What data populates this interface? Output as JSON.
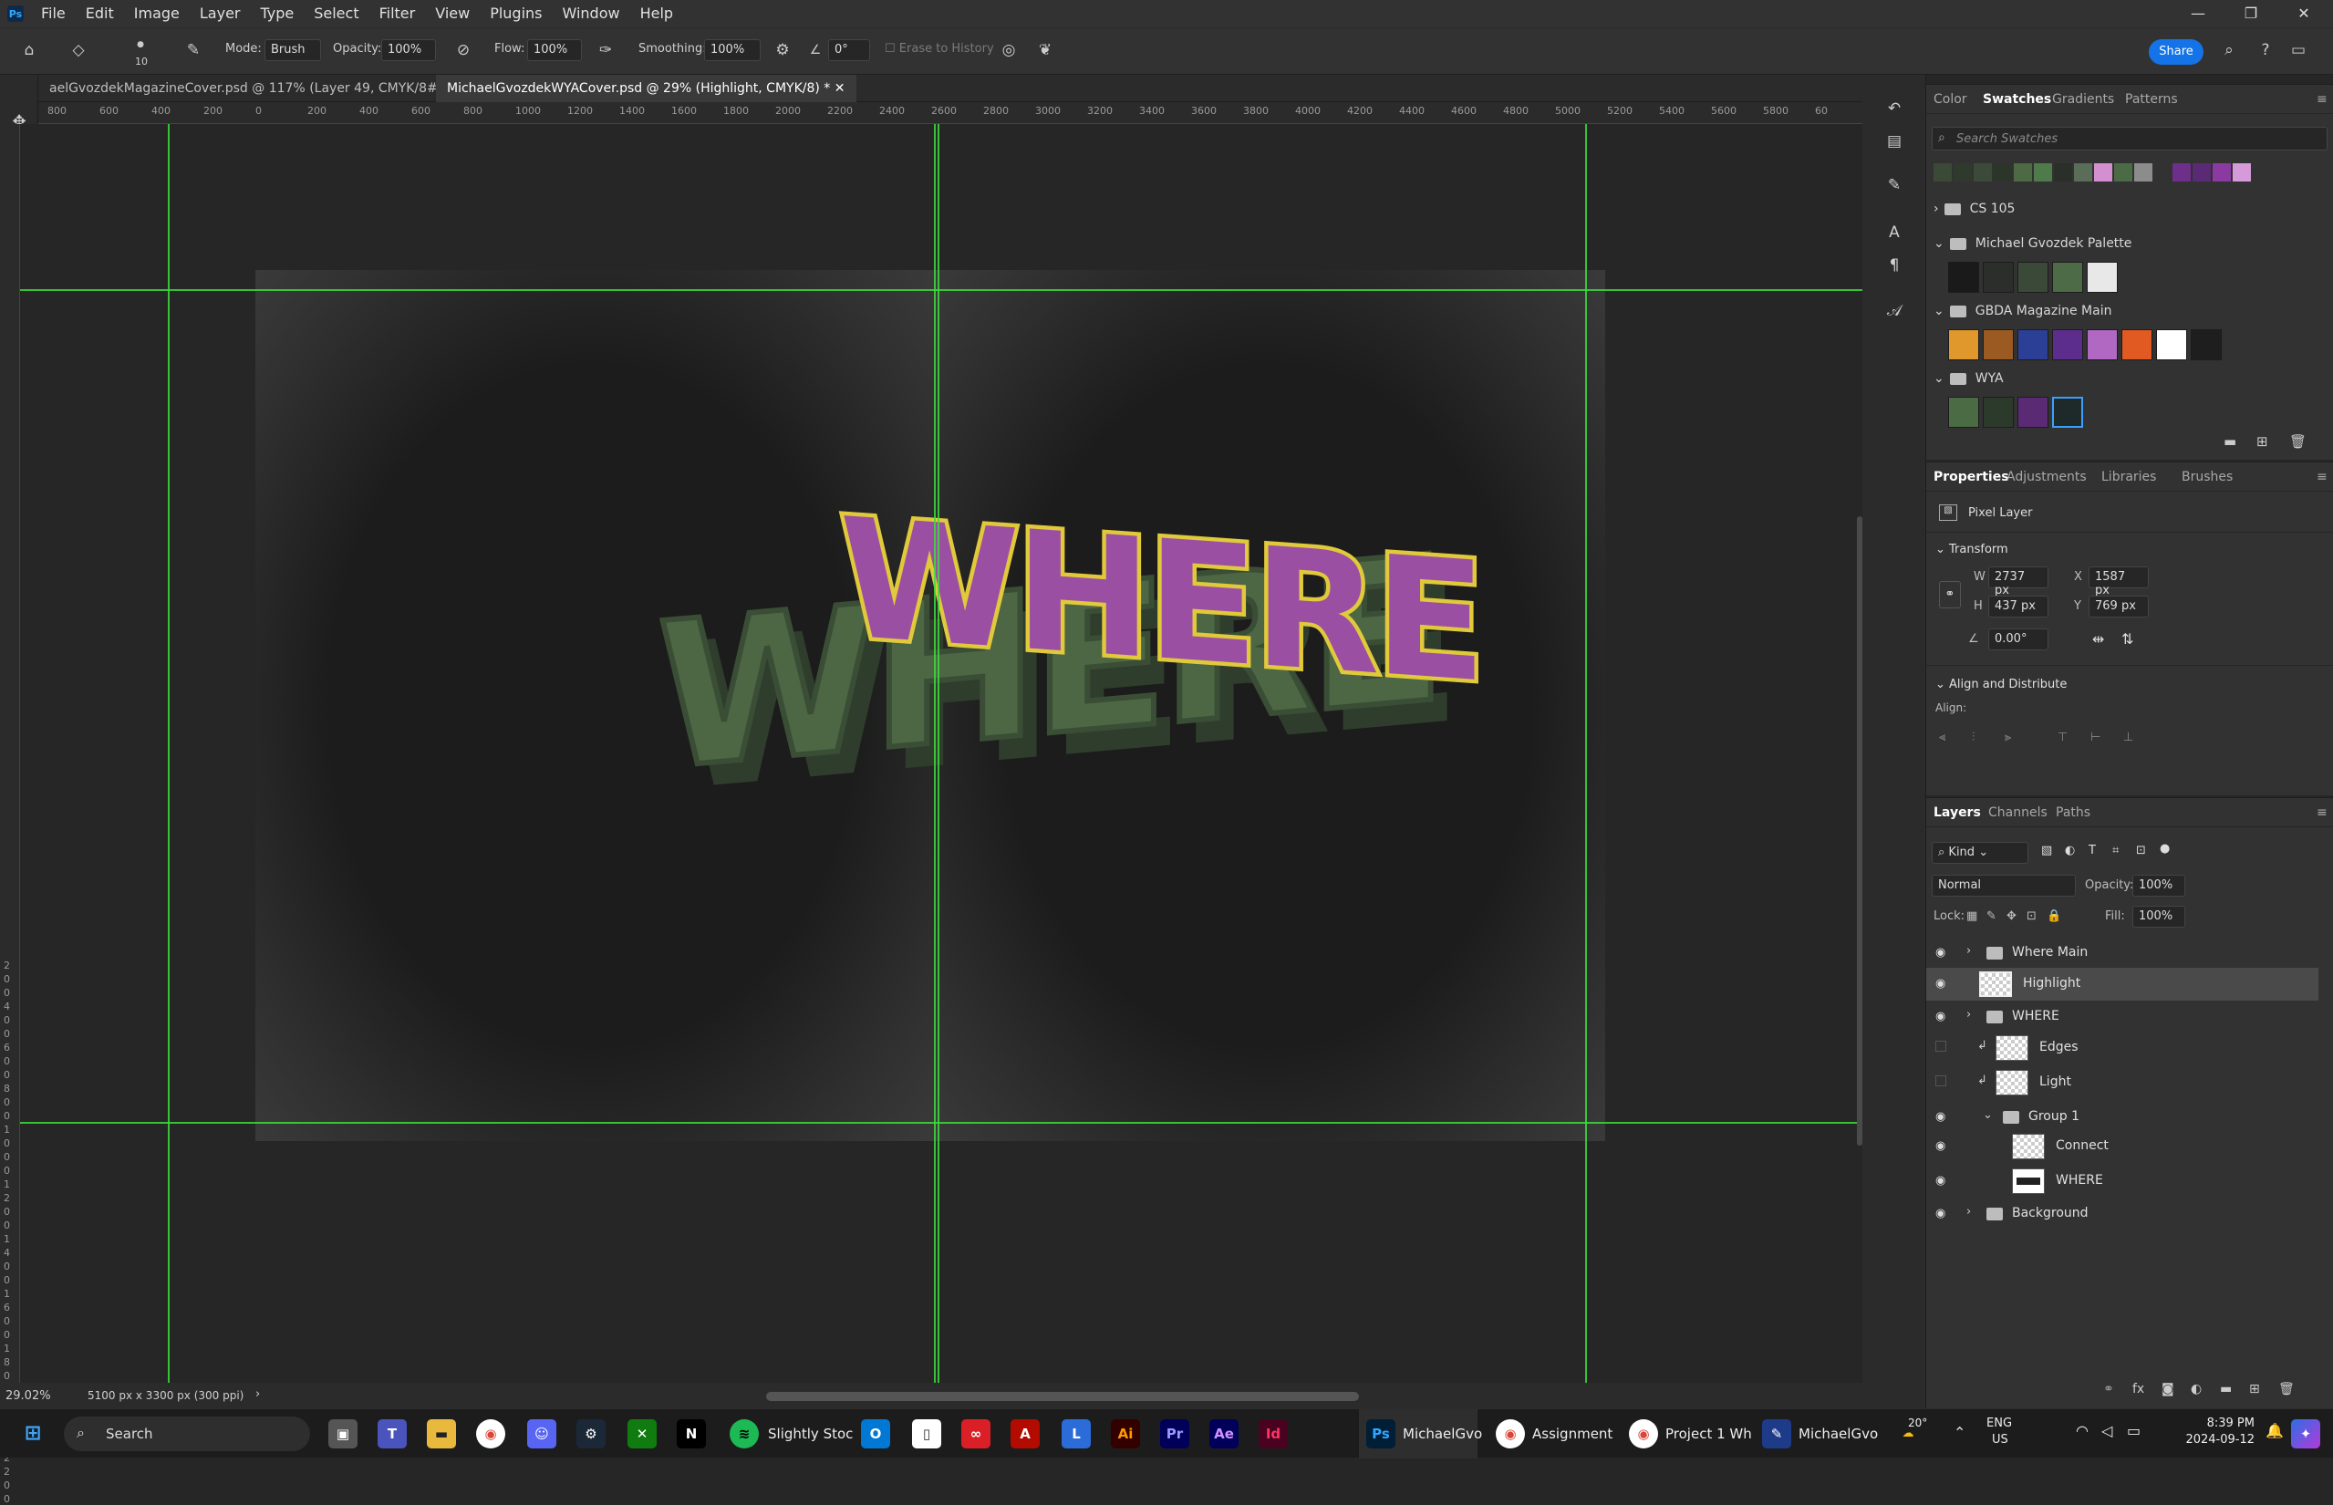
{
  "menu": {
    "logo": "Ps",
    "items": [
      "File",
      "Edit",
      "Image",
      "Layer",
      "Type",
      "Select",
      "Filter",
      "View",
      "Plugins",
      "Window",
      "Help"
    ],
    "win_min": "—",
    "win_restore": "❐",
    "win_close": "✕"
  },
  "options": {
    "brush_size": "10",
    "mode_label": "Mode:",
    "mode_value": "Brush",
    "opacity_label": "Opacity:",
    "opacity_value": "100%",
    "flow_label": "Flow:",
    "flow_value": "100%",
    "smoothing_label": "Smoothing:",
    "smoothing_value": "100%",
    "angle_value": "0°",
    "erase_history": "Erase to History",
    "share": "Share"
  },
  "doc_tabs": [
    {
      "label": "aelGvozdekMagazineCover.psd @ 117% (Layer 49, CMYK/8#) *"
    },
    {
      "label": "MichaelGvozdekWYACover.psd @ 29% (Highlight, CMYK/8) *"
    }
  ],
  "ruler_top": [
    "800",
    "600",
    "400",
    "200",
    "0",
    "200",
    "400",
    "600",
    "800",
    "1000",
    "1200",
    "1400",
    "1600",
    "1800",
    "2000",
    "2200",
    "2400",
    "2600",
    "2800",
    "3000",
    "3200",
    "3400",
    "3600",
    "3800",
    "4000",
    "4200",
    "4400",
    "4600",
    "4800",
    "5000",
    "5200",
    "5400",
    "5600",
    "5800",
    "60"
  ],
  "ruler_left": [
    "2",
    "0",
    "0",
    "4",
    "0",
    "0",
    "6",
    "0",
    "0",
    "8",
    "0",
    "0",
    "1",
    "0",
    "0",
    "0",
    "1",
    "2",
    "0",
    "0",
    "1",
    "4",
    "0",
    "0",
    "1",
    "6",
    "0",
    "0",
    "1",
    "8",
    "0",
    "0",
    "2",
    "0",
    "0",
    "0",
    "2",
    "2",
    "0",
    "0"
  ],
  "status": {
    "zoom": "29.02%",
    "doc_size": "5100 px x 3300 px (300 ppi)"
  },
  "swatches_panel": {
    "tabs": [
      "Color",
      "Swatches",
      "Gradients",
      "Patterns"
    ],
    "search_placeholder": "Search Swatches",
    "recent": [
      "#3a4a36",
      "#2f3a2d",
      "#3c4a39",
      "#2b352a",
      "#4d6a45",
      "#4f7a4a",
      "#2a2f29",
      "#5a6d58",
      "#d48fd0",
      "#4b6b47",
      "#8c8c8c",
      "#6d2f8a",
      "#5a2a75",
      "#8a3aa0",
      "#d49ad9"
    ],
    "groups": [
      {
        "name": "CS 105",
        "colors": []
      },
      {
        "name": "Michael Gvozdek Palette",
        "colors": [
          "#1a1a1a",
          "#2b2e2b",
          "#3b4a38",
          "#4e6b47",
          "#e8e8e8"
        ]
      },
      {
        "name": "GBDA Magazine Main",
        "colors": [
          "#e0972b",
          "#9a5a22",
          "#2b3f96",
          "#5c2d8c",
          "#b068c2",
          "#e05a22",
          "#ffffff",
          "#1e1e1e"
        ]
      },
      {
        "name": "WYA",
        "colors": [
          "#4b6b44",
          "#2b3a2b",
          "#5a2a75",
          "#1e2a2a"
        ]
      }
    ]
  },
  "properties": {
    "tabs": [
      "Properties",
      "Adjustments",
      "Libraries",
      "Brushes"
    ],
    "kind": "Pixel Layer",
    "transform_label": "Transform",
    "w_label": "W",
    "w": "2737 px",
    "h_label": "H",
    "h": "437 px",
    "x_label": "X",
    "x": "1587 px",
    "y_label": "Y",
    "y": "769 px",
    "angle": "0.00°",
    "align_label": "Align and Distribute",
    "align_sub": "Align:"
  },
  "layers_panel": {
    "tabs": [
      "Layers",
      "Channels",
      "Paths"
    ],
    "filter_kind": "Kind",
    "blend_mode": "Normal",
    "opacity_label": "Opacity:",
    "opacity": "100%",
    "lock_label": "Lock:",
    "fill_label": "Fill:",
    "fill": "100%",
    "layers": [
      {
        "name": "Where Main",
        "type": "group",
        "visible": true,
        "indent": 0
      },
      {
        "name": "Highlight",
        "type": "pixel",
        "visible": true,
        "indent": 0,
        "selected": true
      },
      {
        "name": "WHERE",
        "type": "group",
        "visible": true,
        "indent": 0
      },
      {
        "name": "Edges",
        "type": "pixel",
        "visible": false,
        "indent": 1,
        "clip": true
      },
      {
        "name": "Light",
        "type": "pixel",
        "visible": false,
        "indent": 1,
        "clip": true
      },
      {
        "name": "Group 1",
        "type": "group-open",
        "visible": true,
        "indent": 1
      },
      {
        "name": "Connect",
        "type": "pixel",
        "visible": true,
        "indent": 2
      },
      {
        "name": "WHERE",
        "type": "pixel-art",
        "visible": true,
        "indent": 2
      },
      {
        "name": "Background",
        "type": "group",
        "visible": true,
        "indent": 0
      }
    ]
  },
  "artwork": {
    "top_text": "WHERE",
    "bottom_text": "WHERE",
    "top_fill": "#9b4fa3",
    "top_stroke": "#e0c93a",
    "bottom_fill": "#4d6644",
    "bottom_shadow": "#2f3d2c",
    "guide_color": "#3ddc3d"
  },
  "taskbar": {
    "search": "Search",
    "apps": [
      {
        "label": "Slightly Stoc"
      },
      {
        "label": "MichaelGvo"
      },
      {
        "label": "Assignment"
      },
      {
        "label": "Project 1 Wh"
      },
      {
        "label": "MichaelGvo"
      }
    ],
    "weather": "20°",
    "lang1": "ENG",
    "lang2": "US",
    "time": "8:39 PM",
    "date": "2024-09-12"
  }
}
